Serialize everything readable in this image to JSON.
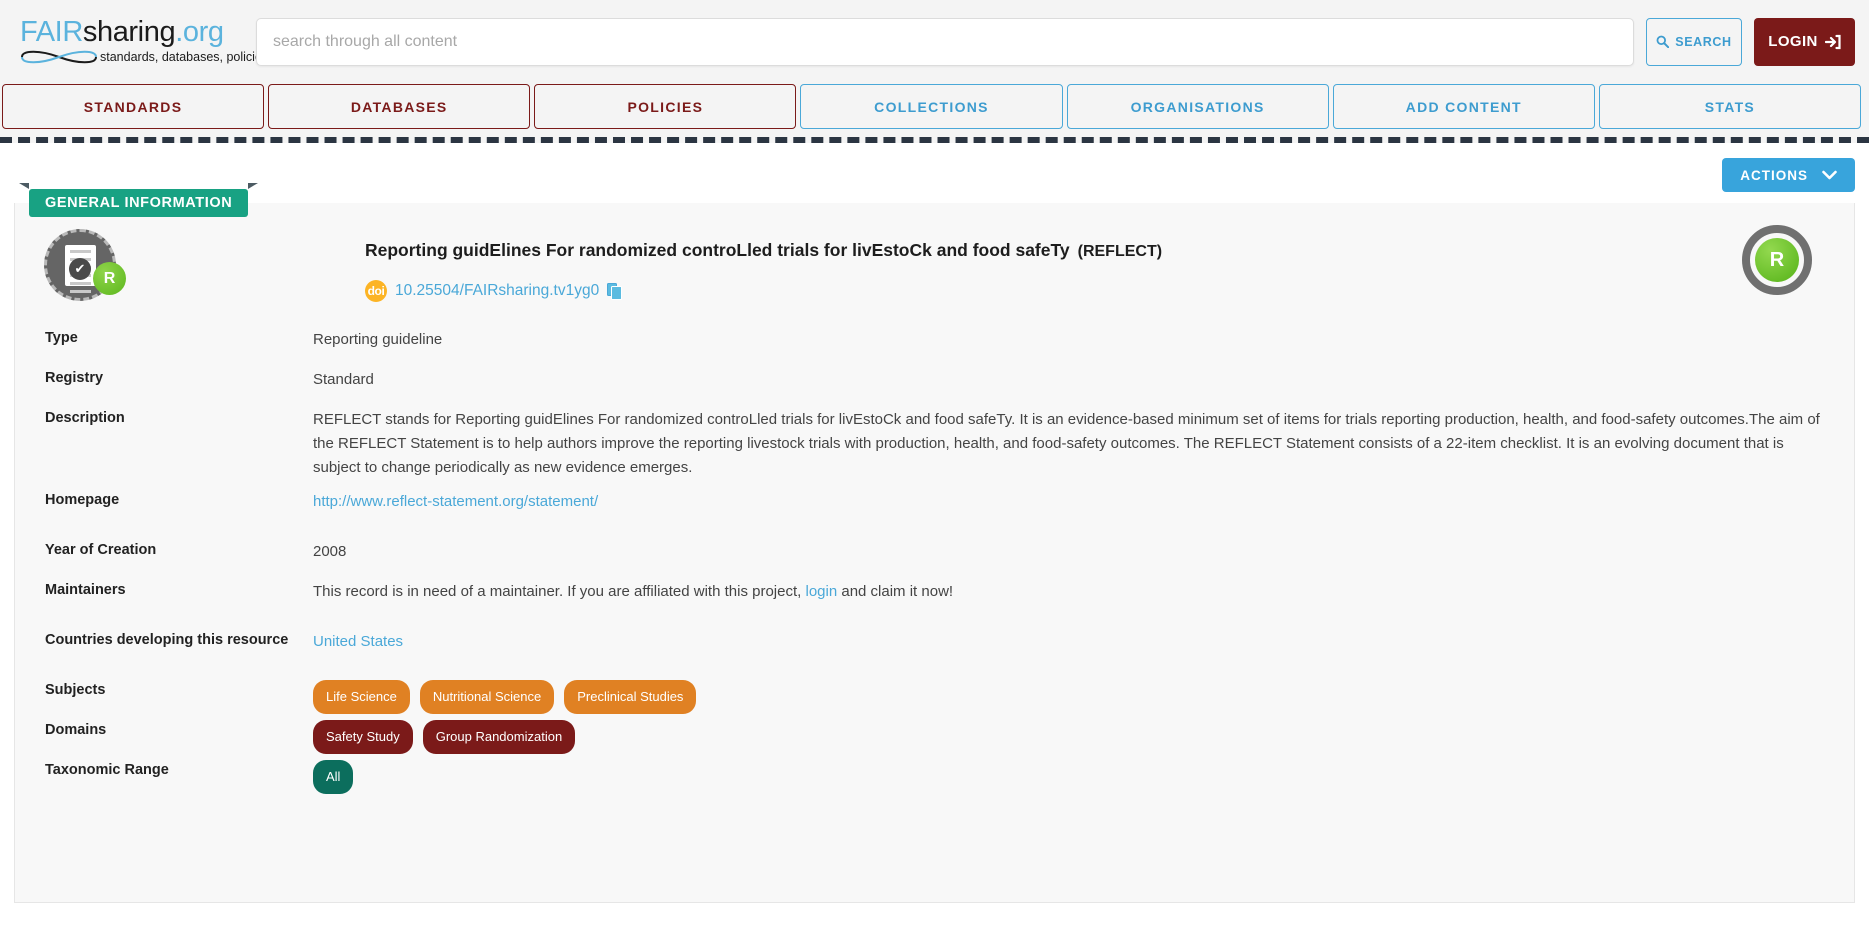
{
  "header": {
    "logo": {
      "fair": "FAIR",
      "sharing": "sharing",
      "org": ".org",
      "tagline": "standards, databases, policies"
    },
    "search": {
      "placeholder": "search through all content",
      "value": "",
      "button_label": "SEARCH",
      "icon": "search-icon"
    },
    "login": {
      "label": "LOGIN",
      "icon": "sign-in-icon"
    }
  },
  "nav": {
    "items": [
      {
        "label": "STANDARDS",
        "style": "maroon"
      },
      {
        "label": "DATABASES",
        "style": "maroon"
      },
      {
        "label": "POLICIES",
        "style": "maroon"
      },
      {
        "label": "COLLECTIONS",
        "style": "blue"
      },
      {
        "label": "ORGANISATIONS",
        "style": "blue"
      },
      {
        "label": "ADD CONTENT",
        "style": "blue"
      },
      {
        "label": "STATS",
        "style": "blue"
      }
    ]
  },
  "toolbar": {
    "actions_label": "ACTIONS",
    "actions_icon": "chevron-down-icon"
  },
  "panel": {
    "ribbon_label": "GENERAL INFORMATION",
    "record_icon": {
      "type": "reporting-guideline-icon",
      "badge_letter": "R"
    },
    "fair_ring": {
      "letter": "R"
    },
    "title": "Reporting guidElines For randomized controLled trials for livEstoCk and food safeTy",
    "abbreviation": "(REFLECT)",
    "doi": {
      "badge": "doi",
      "value": "10.25504/FAIRsharing.tv1yg0",
      "copy_icon": "copy-icon"
    },
    "fields": [
      {
        "label": "Type",
        "value": "Reporting guideline"
      },
      {
        "label": "Registry",
        "value": "Standard"
      },
      {
        "label": "Description",
        "value": "REFLECT stands for Reporting guidElines For randomized controLled trials for livEstoCk and food safeTy. It is an evidence-based minimum set of items for trials reporting production, health, and food-safety outcomes.The aim of the REFLECT Statement is to help authors improve the reporting livestock trials with production, health, and food-safety outcomes. The REFLECT Statement consists of a 22-item checklist. It is an evolving document that is subject to change periodically as new evidence emerges."
      },
      {
        "label": "Homepage",
        "value": "http://www.reflect-statement.org/statement/",
        "is_link": true
      },
      {
        "label": "Year of Creation",
        "value": "2008"
      },
      {
        "label": "Maintainers",
        "text_before": "This record is in need of a maintainer. If you are affiliated with this project,",
        "link_text": "login",
        "text_after": "and claim it now!"
      },
      {
        "label": "Countries developing this resource",
        "value": "United States",
        "is_link": true
      },
      {
        "label": "Subjects",
        "pills": [
          "Life Science",
          "Nutritional Science",
          "Preclinical Studies"
        ],
        "pill_style": "subject"
      },
      {
        "label": "Domains",
        "pills": [
          "Safety Study",
          "Group Randomization"
        ],
        "pill_style": "domain"
      },
      {
        "label": "Taxonomic Range",
        "pills": [
          "All"
        ],
        "pill_style": "taxon"
      }
    ]
  },
  "colors": {
    "brand_blue": "#4aa8d8",
    "brand_maroon": "#7b1a19",
    "ribbon_teal": "#18a283",
    "actions_blue": "#38a4dc",
    "subject_orange": "#e08123",
    "taxon_teal": "#0c6e5d",
    "doi_amber": "#fcb425"
  }
}
